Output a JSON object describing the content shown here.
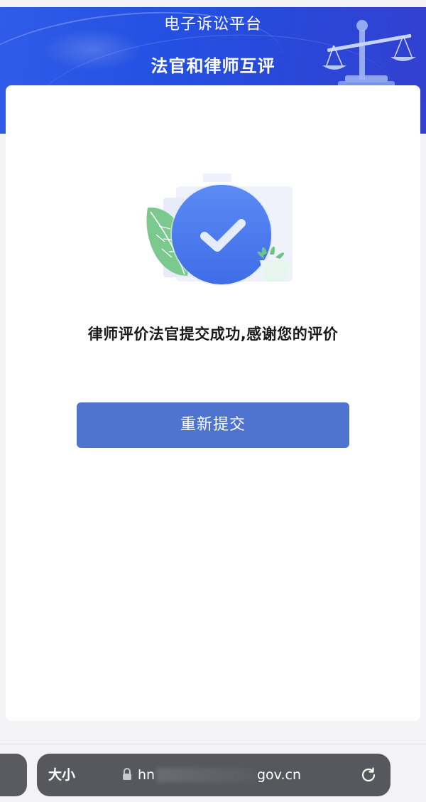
{
  "header": {
    "platform_title": "电子诉讼平台",
    "page_title": "法官和律师互评"
  },
  "result": {
    "message": "律师评价法官提交成功,感谢您的评价",
    "resubmit_label": "重新提交",
    "icon": "check-circle-icon"
  },
  "browser": {
    "text_size_label": "大小",
    "url_left": "hn",
    "url_right": "gov.cn",
    "lock_icon": "lock-icon",
    "reload_icon": "reload-icon"
  },
  "colors": {
    "header_blue": "#2450e2",
    "button_blue": "#4f74d0",
    "leaf_green": "#7cc98f"
  }
}
